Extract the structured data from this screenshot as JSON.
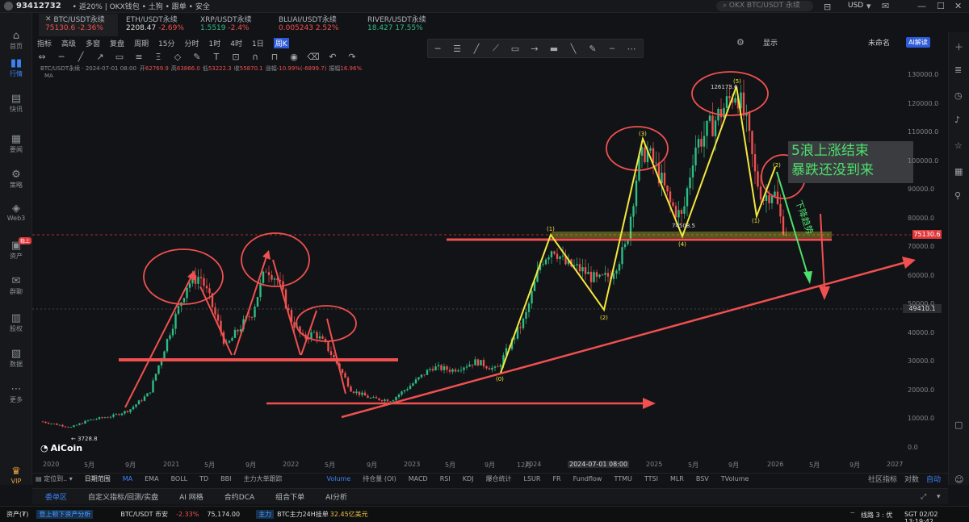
{
  "titlebar": {
    "uid": "93412732",
    "promo": "• 返20% | OKX钱包 • 土狗 • 跟单 • 安全",
    "search_placeholder": "OKX BTC/USDT 永续",
    "currency": "USD"
  },
  "sidebar": [
    {
      "label": "首页",
      "icon": "home-icon"
    },
    {
      "label": "行情",
      "icon": "chart-icon",
      "active": true
    },
    {
      "label": "快讯",
      "icon": "news-icon"
    },
    {
      "label": "要闻",
      "icon": "article-icon"
    },
    {
      "label": "策略",
      "icon": "robot-icon"
    },
    {
      "label": "Web3",
      "icon": "web3-icon"
    },
    {
      "label": "资产",
      "icon": "wallet-icon",
      "badge": "稳上"
    },
    {
      "label": "群聊",
      "icon": "chat-icon"
    },
    {
      "label": "股权",
      "icon": "stock-icon"
    },
    {
      "label": "数据",
      "icon": "data-icon"
    },
    {
      "label": "更多",
      "icon": "more-icon"
    },
    {
      "label": "VIP",
      "icon": "vip-icon"
    }
  ],
  "tickers": [
    {
      "name": "BTC/USDT永续",
      "price": "75130.6",
      "change": "-2.36%",
      "active": true
    },
    {
      "name": "ETH/USDT永续",
      "price": "2208.47",
      "change": "-2.69%"
    },
    {
      "name": "XRP/USDT永续",
      "price": "1.5519",
      "change": "-2.4%"
    },
    {
      "name": "BLUAI/USDT永续",
      "price": "0.005243",
      "change": "2.52%"
    },
    {
      "name": "RIVER/USDT永续",
      "price": "18.427",
      "change": "17.55%"
    }
  ],
  "toolbar1": [
    "指标",
    "高级",
    "多窗",
    "复盘",
    "周期",
    "15分",
    "分时",
    "1时",
    "4时",
    "1日",
    "周K"
  ],
  "toolbar1_selected": "周K",
  "toolbar1_right": [
    "显示",
    "未命名"
  ],
  "ai_button": "AI解读",
  "ohlc": {
    "symbol_line": "BTC/USDT永续 · 2024-07-01 08:00",
    "open_label": "开",
    "open": "62769.9",
    "high_label": "高",
    "high": "63866.0",
    "low_label": "低",
    "low": "53222.3",
    "close_label": "收",
    "close": "55870.1",
    "change_label": "涨幅",
    "change": "-10.99%(-6899.7)",
    "amp_label": "振幅",
    "amp": "16.96%",
    "ma": "MA"
  },
  "price_labels": {
    "current": "75130.6",
    "crosshair": "49410.1"
  },
  "y_axis": [
    "130000.0",
    "120000.0",
    "110000.0",
    "100000.0",
    "90000.0",
    "80000.0",
    "70000.0",
    "60000.0",
    "50000.0",
    "40000.0",
    "30000.0",
    "20000.0",
    "10000.0",
    "0.0"
  ],
  "x_axis": [
    "2020",
    "5月",
    "9月",
    "2021",
    "5月",
    "9月",
    "2022",
    "5月",
    "9月",
    "2023",
    "5月",
    "9月",
    "12月",
    "2024",
    "2024-07-01 08:00",
    "2025",
    "5月",
    "9月",
    "2026",
    "5月",
    "9月",
    "2027"
  ],
  "chart_annotations": {
    "low_label": "3728.8",
    "ath_label": "126173.6",
    "mid_label": "74508.5",
    "wave_labels": [
      "(1)",
      "(2)",
      "(3)",
      "(4)",
      "(5)",
      "(1)",
      "(2)",
      "(0)"
    ],
    "callout_line1": "5浪上涨结束",
    "callout_line2": "暴跌还没到来",
    "down_text": "下降趋势"
  },
  "logo": "AiCoin",
  "indicators": [
    "MA",
    "EMA",
    "BOLL",
    "TD",
    "BBI",
    "主力大单跟踪",
    "Volume",
    "持仓量 (OI)",
    "MACD",
    "RSI",
    "KDJ",
    "爆仓统计",
    "LSUR",
    "FR",
    "Fundflow",
    "TTMU",
    "TTSI",
    "MLR",
    "BSV",
    "TVolume"
  ],
  "indicators_right": [
    "社区指标",
    "对数",
    "自动"
  ],
  "bottom_tabs": [
    "委单区",
    "自定义指标/回测/实盘",
    "AI 网格",
    "合约DCA",
    "组合下单",
    "AI分析"
  ],
  "status": {
    "asset": "资产(₮)",
    "asset_link": "登上顿下资产分析",
    "pair": "BTC/USDT 币安",
    "pair_change": "-2.33%",
    "pair_price": "75,174.00",
    "tag": "主力",
    "flow": "BTC主力24H挂单",
    "flow_value": "32.45亿美元",
    "line": "线路 3 : 优",
    "time": "SGT 02/02 13:19:42"
  },
  "colors": {
    "bg": "#121316",
    "up": "#2ebd85",
    "down": "#f0504f",
    "accent": "#3b82f6",
    "wave": "#f2e83d",
    "annot": "#f05050",
    "callout": "#4ee06c"
  }
}
